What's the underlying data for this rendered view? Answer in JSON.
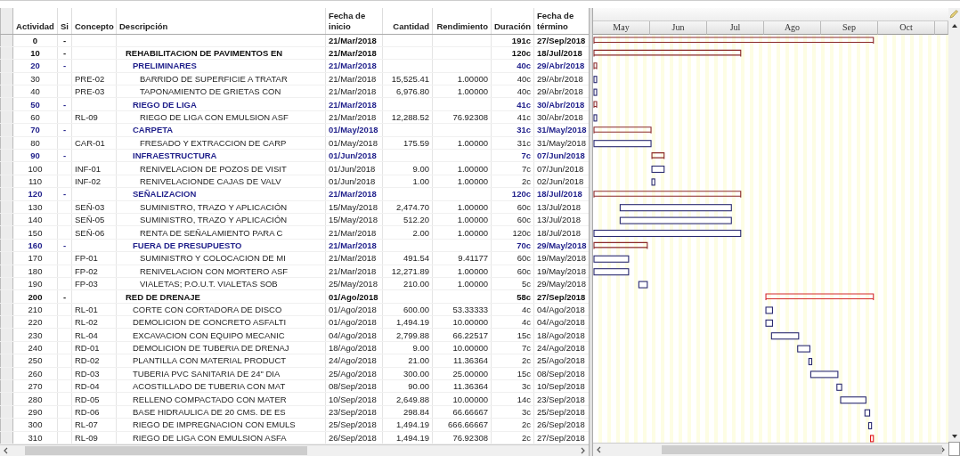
{
  "columns": [
    {
      "lines": [
        "Actividad"
      ]
    },
    {
      "lines": [
        "Si"
      ]
    },
    {
      "lines": [
        "Concepto"
      ]
    },
    {
      "lines": [
        "Descripción"
      ]
    },
    {
      "lines": [
        "Fecha de",
        "inicio"
      ]
    },
    {
      "lines": [
        "Cantidad"
      ]
    },
    {
      "lines": [
        "Rendimiento"
      ]
    },
    {
      "lines": [
        "Duración"
      ]
    },
    {
      "lines": [
        "Fecha de",
        "término"
      ]
    }
  ],
  "months": [
    "May",
    "Jun",
    "Jul",
    "Ago",
    "Sep",
    "Oct"
  ],
  "rows": [
    {
      "kind": "summary",
      "id": "0",
      "sig": "-",
      "description": "",
      "start": "21/Mar/2018",
      "duration": "191c",
      "end": "27/Sep/2018",
      "critical": false,
      "children": [
        {
          "kind": "summary",
          "id": "10",
          "sig": "-",
          "description": "REHABILITACION DE PAVIMENTOS EN",
          "start": "21/Mar/2018",
          "duration": "120c",
          "end": "18/Jul/2018",
          "critical": false,
          "children": [
            {
              "kind": "summary",
              "id": "20",
              "sig": "-",
              "description": "PRELIMINARES",
              "start": "21/Mar/2018",
              "duration": "40c",
              "end": "29/Abr/2018",
              "critical": false,
              "children": [
                {
                  "kind": "task",
                  "id": "30",
                  "concept": "PRE-02",
                  "description": "BARRIDO DE SUPERFICIE A TRATAR",
                  "start": "21/Mar/2018",
                  "quantity": "15,525.41",
                  "yield": "1.00000",
                  "duration": "40c",
                  "end": "29/Abr/2018",
                  "critical": false
                },
                {
                  "kind": "task",
                  "id": "40",
                  "concept": "PRE-03",
                  "description": "TAPONAMIENTO DE GRIETAS CON",
                  "start": "21/Mar/2018",
                  "quantity": "6,976.80",
                  "yield": "1.00000",
                  "duration": "40c",
                  "end": "29/Abr/2018",
                  "critical": false
                }
              ]
            },
            {
              "kind": "summary",
              "id": "50",
              "sig": "-",
              "description": "RIEGO DE LIGA",
              "start": "21/Mar/2018",
              "duration": "41c",
              "end": "30/Abr/2018",
              "critical": false,
              "children": [
                {
                  "kind": "task",
                  "id": "60",
                  "concept": "RL-09",
                  "description": "RIEGO DE LIGA CON EMULSION ASF",
                  "start": "21/Mar/2018",
                  "quantity": "12,288.52",
                  "yield": "76.92308",
                  "duration": "41c",
                  "end": "30/Abr/2018",
                  "critical": false
                }
              ]
            },
            {
              "kind": "summary",
              "id": "70",
              "sig": "-",
              "description": "CARPETA",
              "start": "01/May/2018",
              "duration": "31c",
              "end": "31/May/2018",
              "critical": false,
              "children": [
                {
                  "kind": "task",
                  "id": "80",
                  "concept": "CAR-01",
                  "description": "FRESADO Y EXTRACCION DE CARP",
                  "start": "01/May/2018",
                  "quantity": "175.59",
                  "yield": "1.00000",
                  "duration": "31c",
                  "end": "31/May/2018",
                  "critical": false
                }
              ]
            },
            {
              "kind": "summary",
              "id": "90",
              "sig": "-",
              "description": "INFRAESTRUCTURA",
              "start": "01/Jun/2018",
              "duration": "7c",
              "end": "07/Jun/2018",
              "critical": false,
              "children": [
                {
                  "kind": "task",
                  "id": "100",
                  "concept": "INF-01",
                  "description": "RENIVELACION DE POZOS DE VISIT",
                  "start": "01/Jun/2018",
                  "quantity": "9.00",
                  "yield": "1.00000",
                  "duration": "7c",
                  "end": "07/Jun/2018",
                  "critical": false
                },
                {
                  "kind": "task",
                  "id": "110",
                  "concept": "INF-02",
                  "description": "RENIVELACIONDE CAJAS DE VALV",
                  "start": "01/Jun/2018",
                  "quantity": "1.00",
                  "yield": "1.00000",
                  "duration": "2c",
                  "end": "02/Jun/2018",
                  "critical": false
                }
              ]
            },
            {
              "kind": "summary",
              "id": "120",
              "sig": "-",
              "description": "SEÑALIZACION",
              "start": "21/Mar/2018",
              "duration": "120c",
              "end": "18/Jul/2018",
              "critical": false,
              "children": [
                {
                  "kind": "task",
                  "id": "130",
                  "concept": "SEÑ-03",
                  "description": "SUMINISTRO, TRAZO Y APLICACIÓN",
                  "start": "15/May/2018",
                  "quantity": "2,474.70",
                  "yield": "1.00000",
                  "duration": "60c",
                  "end": "13/Jul/2018",
                  "critical": false
                },
                {
                  "kind": "task",
                  "id": "140",
                  "concept": "SEÑ-05",
                  "description": "SUMINISTRO, TRAZO Y APLICACIÓN",
                  "start": "15/May/2018",
                  "quantity": "512.20",
                  "yield": "1.00000",
                  "duration": "60c",
                  "end": "13/Jul/2018",
                  "critical": false
                },
                {
                  "kind": "task",
                  "id": "150",
                  "concept": "SEÑ-06",
                  "description": "RENTA DE SEÑALAMIENTO PARA C",
                  "start": "21/Mar/2018",
                  "quantity": "2.00",
                  "yield": "1.00000",
                  "duration": "120c",
                  "end": "18/Jul/2018",
                  "critical": false
                }
              ]
            },
            {
              "kind": "summary",
              "id": "160",
              "sig": "-",
              "description": "FUERA DE PRESUPUESTO",
              "start": "21/Mar/2018",
              "duration": "70c",
              "end": "29/May/2018",
              "critical": false,
              "children": [
                {
                  "kind": "task",
                  "id": "170",
                  "concept": "FP-01",
                  "description": "SUMINISTRO Y COLOCACION DE MI",
                  "start": "21/Mar/2018",
                  "quantity": "491.54",
                  "yield": "9.41177",
                  "duration": "60c",
                  "end": "19/May/2018",
                  "critical": false
                },
                {
                  "kind": "task",
                  "id": "180",
                  "concept": "FP-02",
                  "description": "RENIVELACION CON MORTERO ASF",
                  "start": "21/Mar/2018",
                  "quantity": "12,271.89",
                  "yield": "1.00000",
                  "duration": "60c",
                  "end": "19/May/2018",
                  "critical": false
                },
                {
                  "kind": "task",
                  "id": "190",
                  "concept": "FP-03",
                  "description": "VIALETAS; P.O.U.T. VIALETAS SOB",
                  "start": "25/May/2018",
                  "quantity": "210.00",
                  "yield": "1.00000",
                  "duration": "5c",
                  "end": "29/May/2018",
                  "critical": false
                }
              ]
            }
          ]
        },
        {
          "kind": "summary",
          "id": "200",
          "sig": "-",
          "description": "RED DE DRENAJE",
          "start": "01/Ago/2018",
          "duration": "58c",
          "end": "27/Sep/2018",
          "critical": true,
          "children": [
            {
              "kind": "task",
              "id": "210",
              "concept": "RL-01",
              "description": "CORTE CON CORTADORA DE DISCO",
              "start": "01/Ago/2018",
              "quantity": "600.00",
              "yield": "53.33333",
              "duration": "4c",
              "end": "04/Ago/2018",
              "critical": false
            },
            {
              "kind": "task",
              "id": "220",
              "concept": "RL-02",
              "description": "DEMOLICION DE CONCRETO ASFALTI",
              "start": "01/Ago/2018",
              "quantity": "1,494.19",
              "yield": "10.00000",
              "duration": "4c",
              "end": "04/Ago/2018",
              "critical": false
            },
            {
              "kind": "task",
              "id": "230",
              "concept": "RL-04",
              "description": "EXCAVACION CON EQUIPO MECANIC",
              "start": "04/Ago/2018",
              "quantity": "2,799.88",
              "yield": "66.22517",
              "duration": "15c",
              "end": "18/Ago/2018",
              "critical": false
            },
            {
              "kind": "task",
              "id": "240",
              "concept": "RD-01",
              "description": "DEMOLICION DE TUBERIA DE DRENAJ",
              "start": "18/Ago/2018",
              "quantity": "9.00",
              "yield": "10.00000",
              "duration": "7c",
              "end": "24/Ago/2018",
              "critical": false
            },
            {
              "kind": "task",
              "id": "250",
              "concept": "RD-02",
              "description": "PLANTILLA CON MATERIAL PRODUCT",
              "start": "24/Ago/2018",
              "quantity": "21.00",
              "yield": "11.36364",
              "duration": "2c",
              "end": "25/Ago/2018",
              "critical": false
            },
            {
              "kind": "task",
              "id": "260",
              "concept": "RD-03",
              "description": "TUBERIA PVC SANITARIA DE 24\" DIA",
              "start": "25/Ago/2018",
              "quantity": "300.00",
              "yield": "25.00000",
              "duration": "15c",
              "end": "08/Sep/2018",
              "critical": false
            },
            {
              "kind": "task",
              "id": "270",
              "concept": "RD-04",
              "description": "ACOSTILLADO DE TUBERIA CON MAT",
              "start": "08/Sep/2018",
              "quantity": "90.00",
              "yield": "11.36364",
              "duration": "3c",
              "end": "10/Sep/2018",
              "critical": false
            },
            {
              "kind": "task",
              "id": "280",
              "concept": "RD-05",
              "description": "RELLENO COMPACTADO CON MATER",
              "start": "10/Sep/2018",
              "quantity": "2,649.88",
              "yield": "10.00000",
              "duration": "14c",
              "end": "23/Sep/2018",
              "critical": false
            },
            {
              "kind": "task",
              "id": "290",
              "concept": "RD-06",
              "description": "BASE HIDRAULICA DE 20 CMS. DE ES",
              "start": "23/Sep/2018",
              "quantity": "298.84",
              "yield": "66.66667",
              "duration": "3c",
              "end": "25/Sep/2018",
              "critical": false
            },
            {
              "kind": "task",
              "id": "300",
              "concept": "RL-07",
              "description": "RIEGO DE IMPREGNACION CON EMULS",
              "start": "25/Sep/2018",
              "quantity": "1,494.19",
              "yield": "666.66667",
              "duration": "2c",
              "end": "26/Sep/2018",
              "critical": false
            },
            {
              "kind": "task",
              "id": "310",
              "concept": "RL-09",
              "description": "RIEGO DE LIGA CON EMULSION ASFA",
              "start": "26/Sep/2018",
              "quantity": "1,494.19",
              "yield": "76.92308",
              "duration": "2c",
              "end": "27/Sep/2018",
              "critical": true
            }
          ]
        }
      ]
    }
  ]
}
